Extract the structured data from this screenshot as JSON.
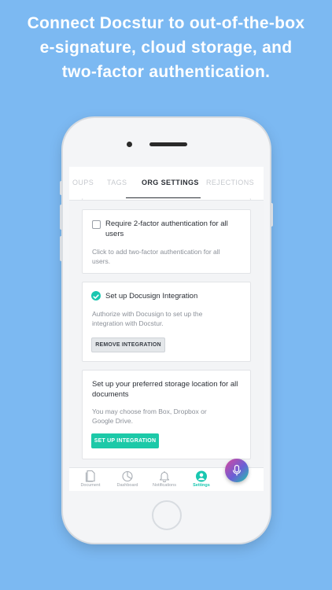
{
  "headline": {
    "line1": "Connect Docstur to out-of-the-box",
    "line2": "e-signature, cloud storage, and",
    "line3": "two-factor authentication."
  },
  "tabs": [
    {
      "label": "OUPS"
    },
    {
      "label": "TAGS"
    },
    {
      "label": "ORG SETTINGS",
      "active": true
    },
    {
      "label": "REJECTIONS"
    }
  ],
  "cards": {
    "two_factor": {
      "title": "Require 2-factor authentication for all users",
      "title_l1": "Require 2-factor authentication for all",
      "title_l2": "users",
      "body_l1": "Click to add two-factor authentication for all",
      "body_l2": "users."
    },
    "docusign": {
      "title": "Set up Docusign Integration",
      "body_l1": "Authorize with Docusign to set up the",
      "body_l2": "integration with Docstur.",
      "button": "REMOVE INTEGRATION"
    },
    "storage": {
      "title_l1": "Set up your preferred storage location for all",
      "title_l2": "documents",
      "body_l1": "You may choose from Box, Dropbox or",
      "body_l2": "Google Drive.",
      "button": "SET UP INTEGRATION"
    }
  },
  "bottom_nav": [
    {
      "label": "Document",
      "icon": "document-icon"
    },
    {
      "label": "Dashboard",
      "icon": "pie-chart-icon"
    },
    {
      "label": "Notifications",
      "icon": "bell-icon"
    },
    {
      "label": "Settings",
      "icon": "user-icon",
      "active": true
    }
  ],
  "colors": {
    "background": "#7cb9f2",
    "accent": "#1cc9a8",
    "text_dark": "#2b2f36",
    "text_muted": "#8b9098"
  }
}
